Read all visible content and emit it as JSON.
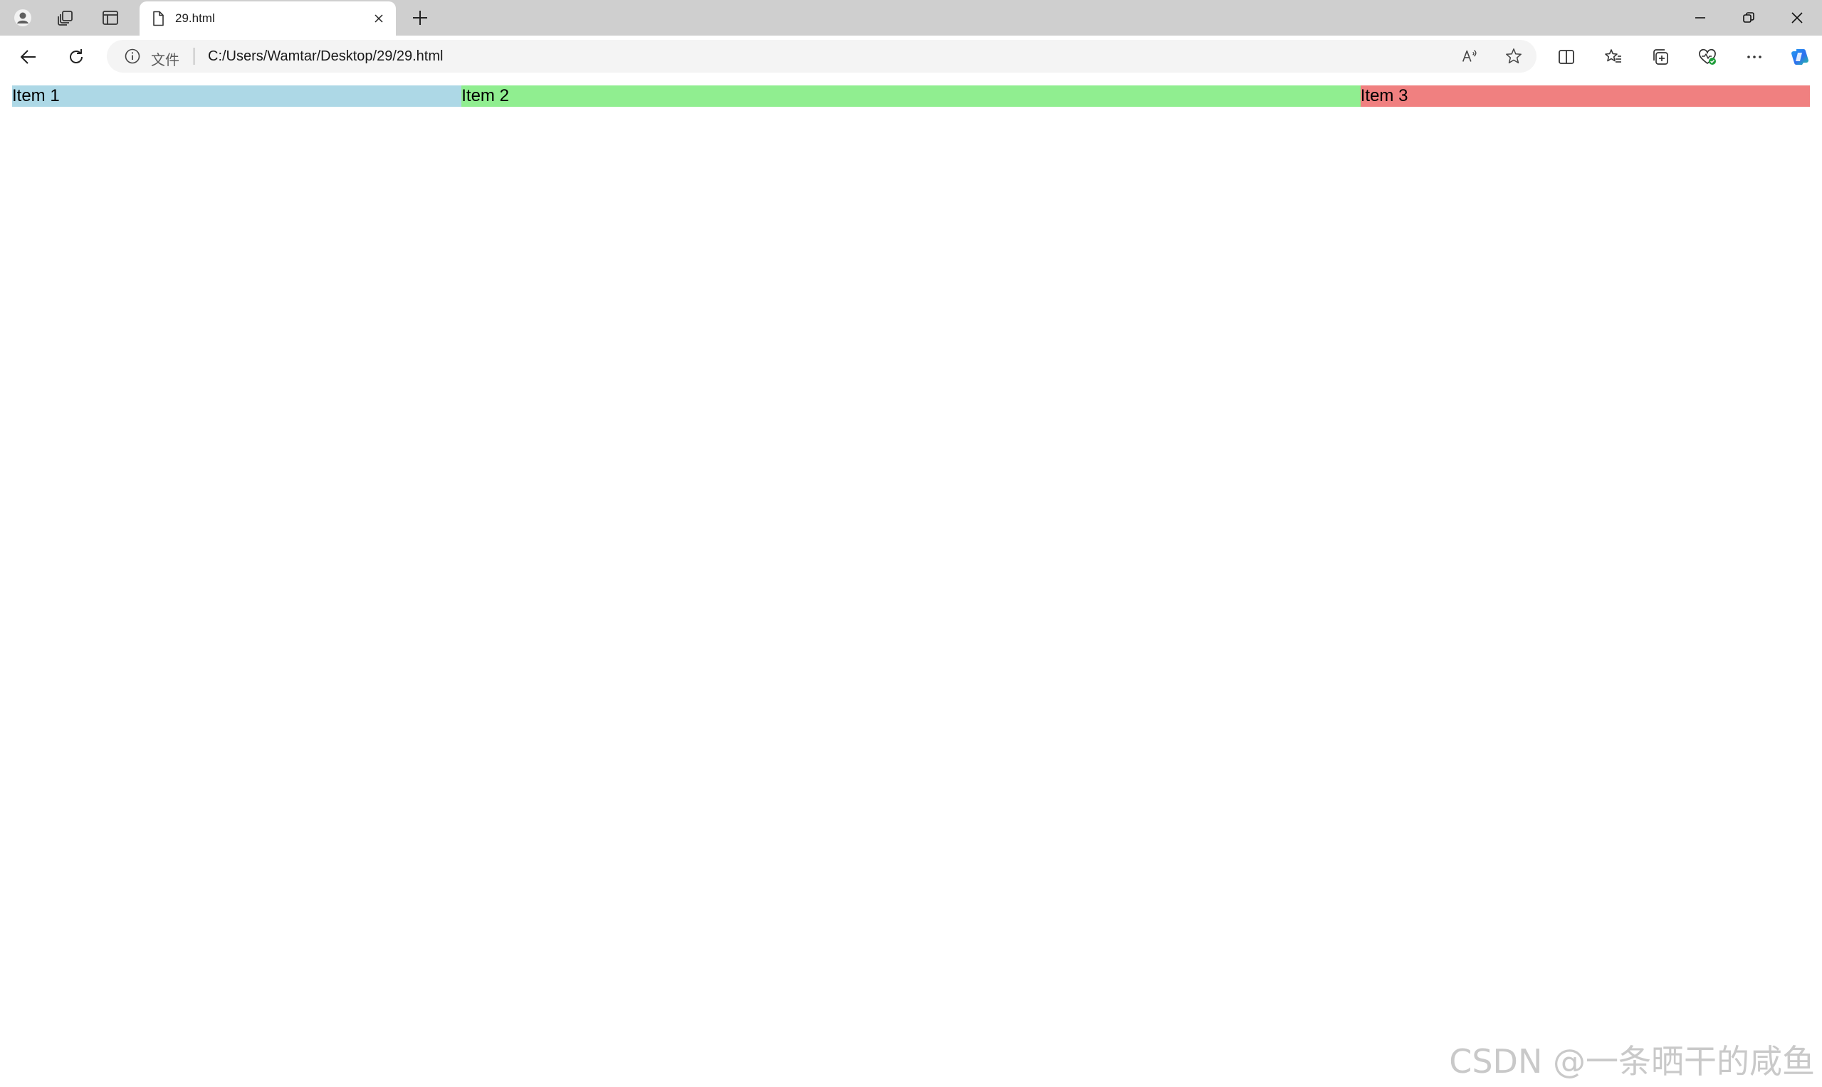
{
  "browser": {
    "tab": {
      "title": "29.html"
    },
    "address": {
      "scheme_label": "文件",
      "url": "C:/Users/Wamtar/Desktop/29/29.html"
    },
    "icons": {
      "profile": "profile-icon",
      "workspaces": "workspaces-icon",
      "vertical_tabs": "vertical-tabs-icon",
      "document": "document-icon",
      "close": "close-icon",
      "new_tab": "plus-icon",
      "back": "arrow-left-icon",
      "refresh": "refresh-icon",
      "info": "info-icon",
      "read_aloud": "read-aloud-icon",
      "favorite": "star-icon",
      "split_screen": "split-screen-icon",
      "favorites": "favorites-icon",
      "collections": "collections-icon",
      "browser_essentials": "heart-pulse-icon",
      "more": "more-icon",
      "copilot": "copilot-icon"
    }
  },
  "page": {
    "items": [
      {
        "label": "Item 1",
        "color": "#add8e6",
        "flex": 1
      },
      {
        "label": "Item 2",
        "color": "#90ee90",
        "flex": 2
      },
      {
        "label": "Item 3",
        "color": "#f08080",
        "flex": 1
      }
    ]
  },
  "watermark": "CSDN @一条晒干的咸鱼"
}
